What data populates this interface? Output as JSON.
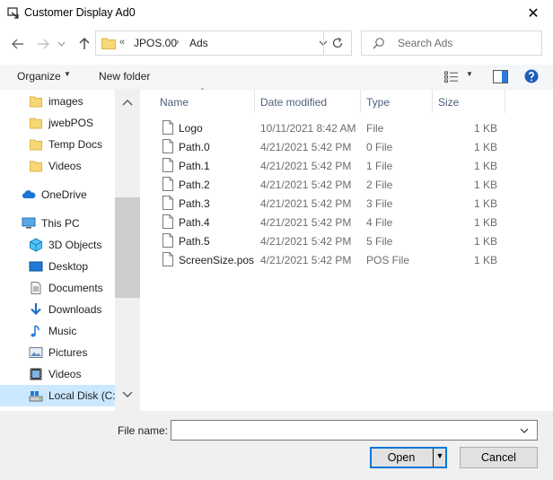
{
  "window": {
    "title": "Customer Display Ad0",
    "close_label": "✕"
  },
  "nav": {
    "breadcrumb_overflow": "«",
    "breadcrumbs": [
      "JPOS.00",
      "Ads"
    ],
    "separator": "›",
    "search_placeholder": "Search Ads"
  },
  "toolbar": {
    "organize_label": "Organize",
    "new_folder_label": "New folder"
  },
  "sidebar": {
    "items": [
      {
        "label": "images",
        "icon": "folder-icon"
      },
      {
        "label": "jwebPOS",
        "icon": "folder-icon"
      },
      {
        "label": "Temp Docs",
        "icon": "folder-icon"
      },
      {
        "label": "Videos",
        "icon": "folder-icon"
      },
      {
        "label": "OneDrive",
        "icon": "cloud-icon"
      },
      {
        "label": "This PC",
        "icon": "pc-icon"
      },
      {
        "label": "3D Objects",
        "icon": "cube-icon"
      },
      {
        "label": "Desktop",
        "icon": "desktop-icon"
      },
      {
        "label": "Documents",
        "icon": "documents-icon"
      },
      {
        "label": "Downloads",
        "icon": "download-icon"
      },
      {
        "label": "Music",
        "icon": "music-icon"
      },
      {
        "label": "Pictures",
        "icon": "pictures-icon"
      },
      {
        "label": "Videos",
        "icon": "video-icon"
      },
      {
        "label": "Local Disk (C:)",
        "icon": "disk-icon"
      }
    ]
  },
  "file_list": {
    "columns": [
      "Name",
      "Date modified",
      "Type",
      "Size"
    ],
    "rows": [
      {
        "name": "Logo",
        "date": "10/11/2021 8:42 AM",
        "type": "File",
        "size": "1 KB"
      },
      {
        "name": "Path.0",
        "date": "4/21/2021 5:42 PM",
        "type": "0 File",
        "size": "1 KB"
      },
      {
        "name": "Path.1",
        "date": "4/21/2021 5:42 PM",
        "type": "1 File",
        "size": "1 KB"
      },
      {
        "name": "Path.2",
        "date": "4/21/2021 5:42 PM",
        "type": "2 File",
        "size": "1 KB"
      },
      {
        "name": "Path.3",
        "date": "4/21/2021 5:42 PM",
        "type": "3 File",
        "size": "1 KB"
      },
      {
        "name": "Path.4",
        "date": "4/21/2021 5:42 PM",
        "type": "4 File",
        "size": "1 KB"
      },
      {
        "name": "Path.5",
        "date": "4/21/2021 5:42 PM",
        "type": "5 File",
        "size": "1 KB"
      },
      {
        "name": "ScreenSize.pos",
        "date": "4/21/2021 5:42 PM",
        "type": "POS File",
        "size": "1 KB"
      }
    ]
  },
  "footer": {
    "file_name_label": "File name:",
    "file_name_value": "",
    "open_label": "Open",
    "cancel_label": "Cancel"
  },
  "colors": {
    "accent": "#0078d7",
    "selection": "#cce8ff",
    "folder": "#f8d775"
  }
}
